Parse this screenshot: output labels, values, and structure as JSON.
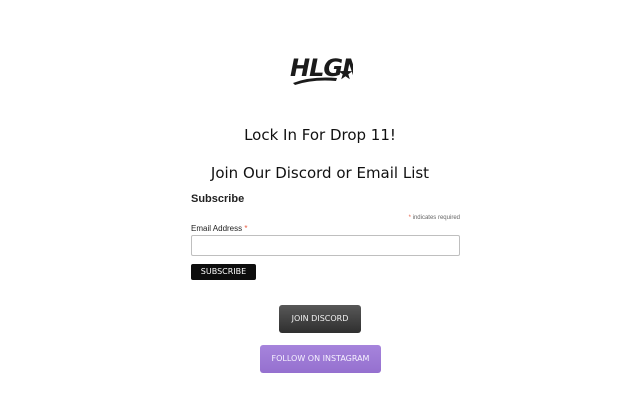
{
  "logo": {
    "text": "HLGN",
    "icon": "star-icon"
  },
  "headings": {
    "drop": "Lock In For Drop 11!",
    "join": "Join Our Discord or Email List"
  },
  "form": {
    "title": "Subscribe",
    "required_marker": "*",
    "required_note": "indicates required",
    "email_label": "Email Address",
    "email_value": "",
    "subscribe_label": "SUBSCRIBE"
  },
  "buttons": {
    "discord_label": "JOIN DISCORD",
    "instagram_label": "FOLLOW ON INSTAGRAM"
  },
  "colors": {
    "required": "#e85c41",
    "subscribe_bg": "#0d0d0d",
    "discord_bg": "#3f3f3f",
    "instagram_bg": "#9b78d4"
  }
}
